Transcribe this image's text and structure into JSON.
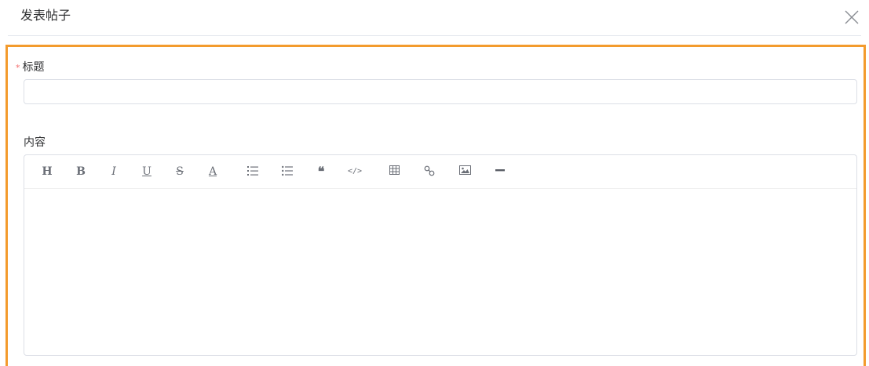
{
  "dialog": {
    "title": "发表帖子",
    "close_icon": "close-icon"
  },
  "form": {
    "title_label": "标题",
    "title_required_mark": "*",
    "title_value": "",
    "title_placeholder": "",
    "content_label": "内容",
    "content_value": ""
  },
  "toolbar": {
    "heading": "H",
    "bold": "B",
    "italic": "I",
    "underline": "U",
    "strike": "S",
    "font_color": "A",
    "quote": "❝",
    "code": "</>",
    "icons": [
      "heading-icon",
      "bold-icon",
      "italic-icon",
      "underline-icon",
      "strikethrough-icon",
      "font-color-icon",
      "ordered-list-icon",
      "unordered-list-icon",
      "quote-icon",
      "code-icon",
      "table-icon",
      "link-icon",
      "image-icon",
      "horizontal-rule-icon"
    ]
  },
  "colors": {
    "highlight_border": "#f39b2d",
    "required_star": "#f56c6c",
    "input_border": "#dcdfe6"
  }
}
